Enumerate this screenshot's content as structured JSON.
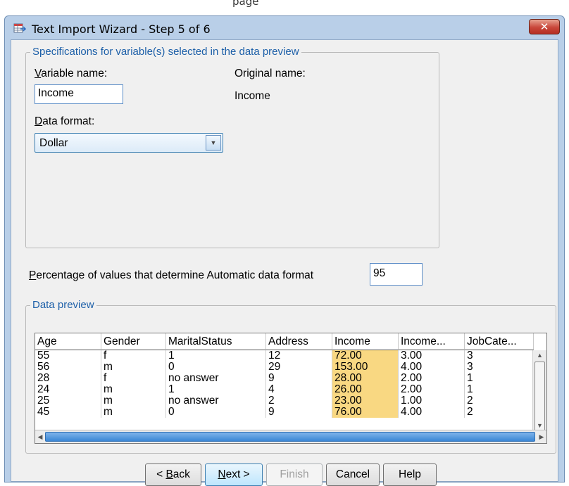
{
  "page_caption": "page",
  "window": {
    "title": "Text Import Wizard - Step 5 of 6",
    "close_glyph": "✕"
  },
  "spec_group": {
    "legend": "Specifications for variable(s) selected in the data preview",
    "variable_name_label": "Variable name:",
    "variable_name_value": "Income",
    "original_name_label": "Original name:",
    "original_name_value": "Income",
    "data_format_label": "Data format:",
    "data_format_value": "Dollar"
  },
  "percentage": {
    "label": "Percentage of values that determine Automatic data format",
    "value": "95"
  },
  "preview": {
    "legend": "Data preview",
    "columns": [
      "Age",
      "Gender",
      "MaritalStatus",
      "Address",
      "Income",
      "Income...",
      "JobCate..."
    ],
    "highlight_column": "Income",
    "rows": [
      [
        "55",
        "f",
        "1",
        "12",
        "72.00",
        "3.00",
        "3"
      ],
      [
        "56",
        "m",
        "0",
        "29",
        "153.00",
        "4.00",
        "3"
      ],
      [
        "28",
        "f",
        "no answer",
        "9",
        "28.00",
        "2.00",
        "1"
      ],
      [
        "24",
        "m",
        "1",
        "4",
        "26.00",
        "2.00",
        "1"
      ],
      [
        "25",
        "m",
        "no answer",
        "2",
        "23.00",
        "1.00",
        "2"
      ],
      [
        "45",
        "m",
        "0",
        "9",
        "76.00",
        "4.00",
        "2"
      ]
    ]
  },
  "buttons": {
    "back": "< Back",
    "next": "Next >",
    "finish": "Finish",
    "cancel": "Cancel",
    "help": "Help"
  },
  "colors": {
    "highlight": "#f9d882",
    "accent": "#1c5fa8",
    "title_bar": "#b9cfe8",
    "close_button": "#c9473a"
  }
}
